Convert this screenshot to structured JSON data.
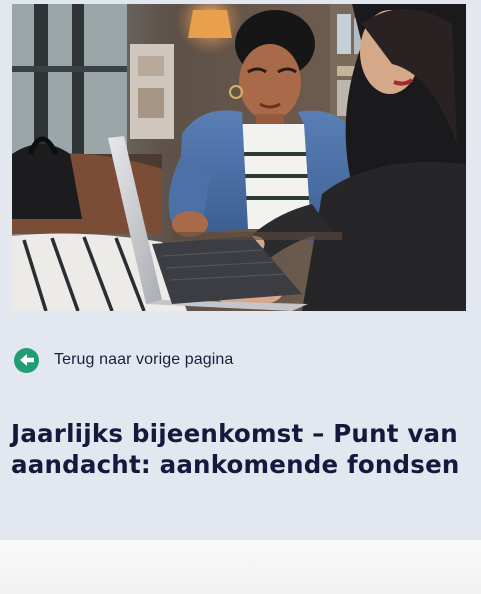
{
  "hero": {
    "image_description": "",
    "icon": "hero-photo"
  },
  "back_link": {
    "label": "Terug naar vorige pagina",
    "icon": "arrow-left-circle-icon"
  },
  "article": {
    "title": "Jaarlijks bijeenkomst – Punt van aandacht: aankomende fondsen"
  },
  "colors": {
    "panel_background": "#e3e7f0",
    "accent_green": "#1f9e75",
    "title_navy": "#15193c",
    "text_dark": "#1c1f3b"
  }
}
